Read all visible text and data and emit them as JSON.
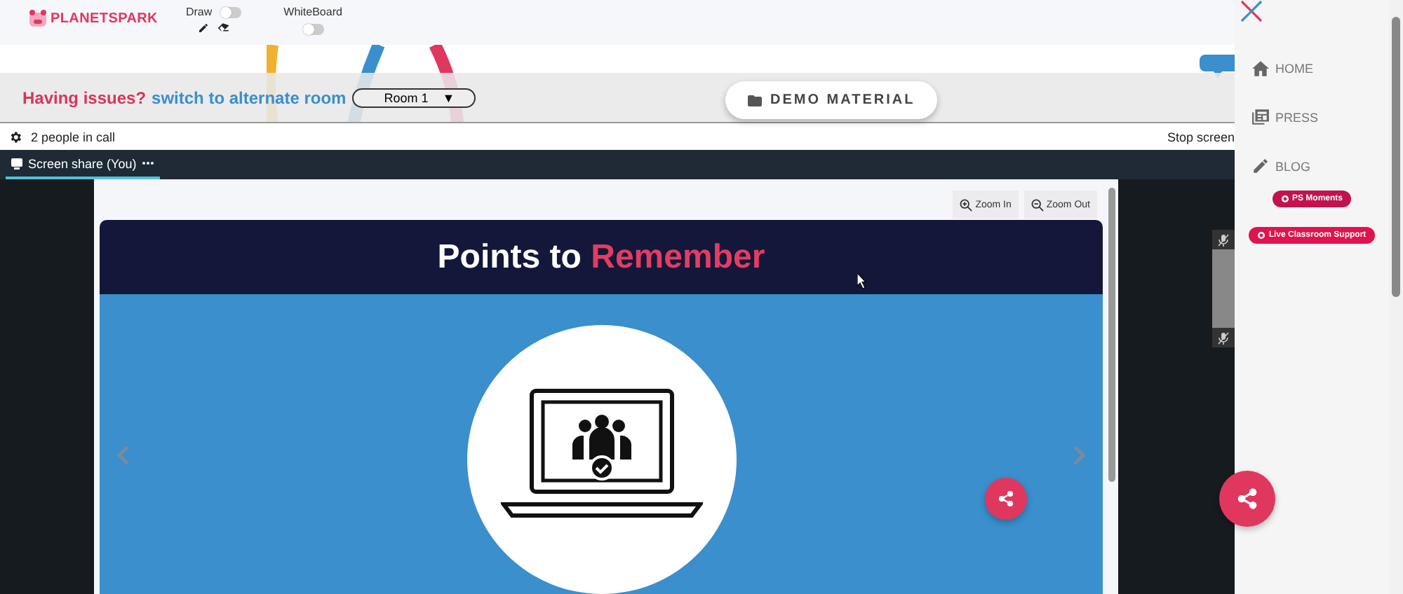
{
  "header": {
    "logo": "PLANETSPARK",
    "draw": {
      "label": "Draw",
      "on": false
    },
    "whiteboard": {
      "label": "WhiteBoard",
      "on": false
    }
  },
  "banner": {
    "issue": "Having issues?",
    "link": "switch to alternate room",
    "room": "Room 1",
    "room_caret": "▼"
  },
  "demo_button": "DEMO MATERIAL",
  "call_bar": {
    "people": "2 people in call",
    "stop": "Stop screen"
  },
  "tabs": [
    {
      "label": "Screen share (You)",
      "selected": true
    }
  ],
  "viewer": {
    "zoom_in": "Zoom In",
    "zoom_out": "Zoom Out",
    "slide_title": "Points to *Remember*"
  },
  "sidebar": {
    "nav": [
      {
        "kind": "home",
        "label": "HOME"
      },
      {
        "kind": "press",
        "label": "PRESS"
      },
      {
        "kind": "blog",
        "label": "BLOG"
      }
    ],
    "buttons": [
      "PS Moments",
      "Live Classroom Support"
    ]
  }
}
